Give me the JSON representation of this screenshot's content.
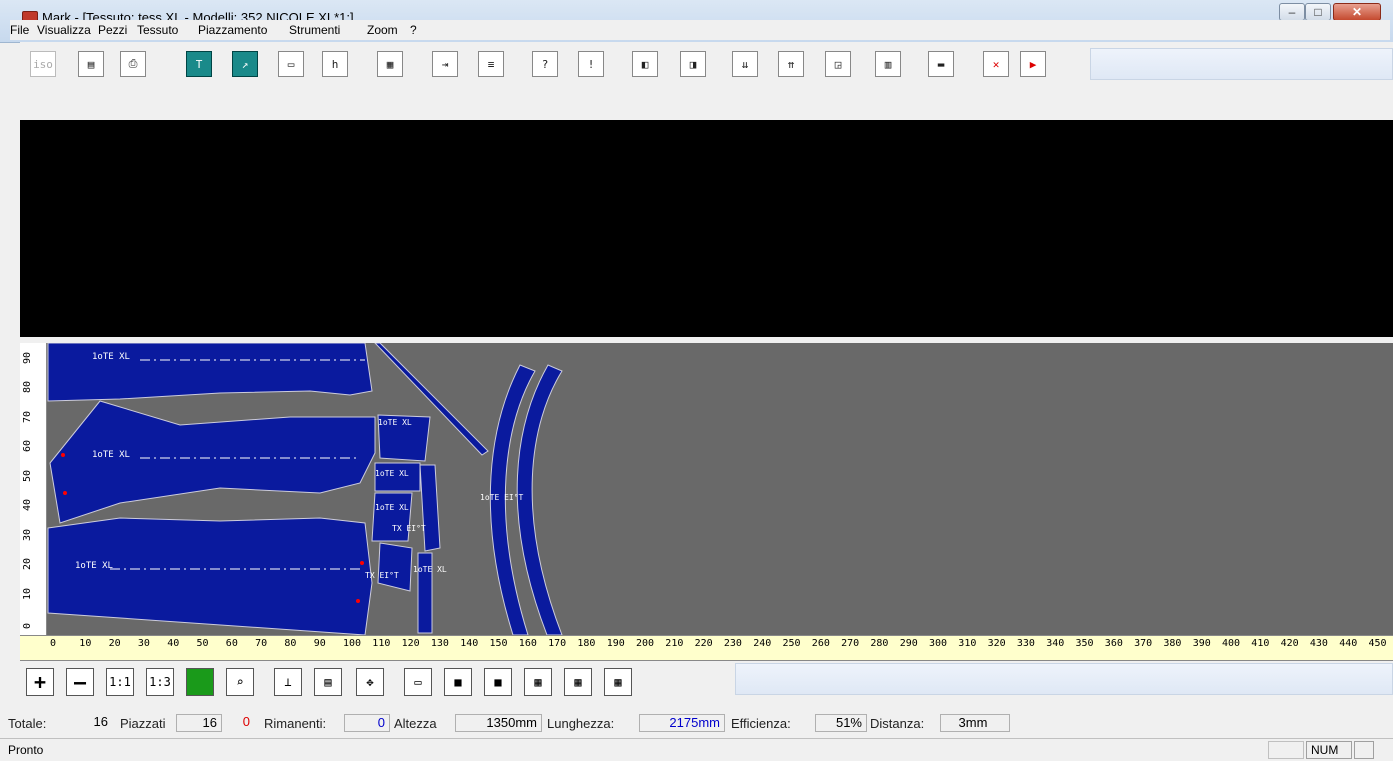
{
  "window": {
    "title": "Mark - [Tessuto: tess XL - Modelli: 352 NICOLE XL*1;]",
    "minimize": "–",
    "maximize": "□",
    "close": "✕"
  },
  "menu": [
    "File",
    "Visualizza",
    "Pezzi",
    "Tessuto",
    "Piazzamento",
    "Strumenti",
    "Zoom",
    "?"
  ],
  "toolbar_top": [
    {
      "name": "iso-button",
      "label": "iso",
      "style": "disabled"
    },
    {
      "name": "save-button",
      "label": "▤",
      "style": "dark"
    },
    {
      "name": "print-button",
      "label": "⎙",
      "style": "dark"
    },
    {
      "name": "text-tool-button",
      "label": "T",
      "style": "teal"
    },
    {
      "name": "arrow-tool-button",
      "label": "↗",
      "style": "teal"
    },
    {
      "name": "width-button",
      "label": "▭",
      "style": "dark"
    },
    {
      "name": "height-button",
      "label": "h",
      "style": "dark"
    },
    {
      "name": "grid-button",
      "label": "▦",
      "style": "dark"
    },
    {
      "name": "insert-button",
      "label": "⇥",
      "style": "dark"
    },
    {
      "name": "list-button",
      "label": "≡",
      "style": "dark"
    },
    {
      "name": "help-button",
      "label": "?",
      "style": "dark"
    },
    {
      "name": "warning-button",
      "label": "!",
      "style": "dark"
    },
    {
      "name": "align-left-button",
      "label": "◧",
      "style": "dark"
    },
    {
      "name": "align-right-button",
      "label": "◨",
      "style": "dark"
    },
    {
      "name": "flip-down-button",
      "label": "⇊",
      "style": "dark"
    },
    {
      "name": "flip-up-button",
      "label": "⇈",
      "style": "dark"
    },
    {
      "name": "frame-button",
      "label": "◲",
      "style": "dark"
    },
    {
      "name": "table-button",
      "label": "▥",
      "style": "dark"
    },
    {
      "name": "ruler-button",
      "label": "▬",
      "style": "dark"
    },
    {
      "name": "delete-button",
      "label": "✕",
      "style": "red"
    },
    {
      "name": "play-button",
      "label": "▶",
      "style": "red"
    }
  ],
  "vertical_ruler": [
    "0",
    "10",
    "20",
    "30",
    "40",
    "50",
    "60",
    "70",
    "80",
    "90"
  ],
  "horizontal_ruler": [
    "0",
    "10",
    "20",
    "30",
    "40",
    "50",
    "60",
    "70",
    "80",
    "90",
    "100",
    "110",
    "120",
    "130",
    "140",
    "150",
    "160",
    "170",
    "180",
    "190",
    "200",
    "210",
    "220",
    "230",
    "240",
    "250",
    "260",
    "270",
    "280",
    "290",
    "300",
    "310",
    "320",
    "330",
    "340",
    "350",
    "360",
    "370",
    "380",
    "390",
    "400",
    "410",
    "420",
    "430",
    "440",
    "450"
  ],
  "piece_labels": {
    "p1": "1oTE XL",
    "p2": "1oTE XL",
    "p3": "1oTE XL",
    "p4": "1oTE XL",
    "p5": "1oTE XL",
    "p6": "1oTE XL",
    "p7": "TX EI°T",
    "p8": "TX EI°T",
    "p9": "1oTE XL",
    "p10": "1oTE EI°T"
  },
  "toolbar_bottom": [
    {
      "name": "zoom-in-button",
      "label": "+"
    },
    {
      "name": "zoom-out-button",
      "label": "—"
    },
    {
      "name": "zoom-1-1-button",
      "label": "1:1"
    },
    {
      "name": "zoom-1-3-button",
      "label": "1:3"
    },
    {
      "name": "fill-button",
      "label": ""
    },
    {
      "name": "magnify-button",
      "label": "⌕"
    },
    {
      "name": "place-button",
      "label": "⊥"
    },
    {
      "name": "layout-button",
      "label": "▤"
    },
    {
      "name": "move-button",
      "label": "✥"
    },
    {
      "name": "screen-button",
      "label": "▭"
    },
    {
      "name": "green-screen-button",
      "label": "■"
    },
    {
      "name": "red-screen-button",
      "label": "■"
    },
    {
      "name": "blocks-button",
      "label": "▦"
    },
    {
      "name": "blocks2-button",
      "label": "▦"
    },
    {
      "name": "blocks3-button",
      "label": "▦"
    }
  ],
  "stats": {
    "totale_label": "Totale:",
    "totale": "16",
    "piazzati_label": "Piazzati",
    "piazzati": "16",
    "zero": "0",
    "rimanenti_label": "Rimanenti:",
    "rimanenti": "0",
    "altezza_label": "Altezza",
    "altezza": "1350mm",
    "lunghezza_label": "Lunghezza:",
    "lunghezza": "2175mm",
    "efficienza_label": "Efficienza:",
    "efficienza": "51%",
    "distanza_label": "Distanza:",
    "distanza": "3mm"
  },
  "status": {
    "ready": "Pronto",
    "num": "NUM"
  },
  "colors": {
    "piece_fill": "#0a1a9e",
    "canvas": "#696969",
    "teal": "#1a8a8a"
  }
}
